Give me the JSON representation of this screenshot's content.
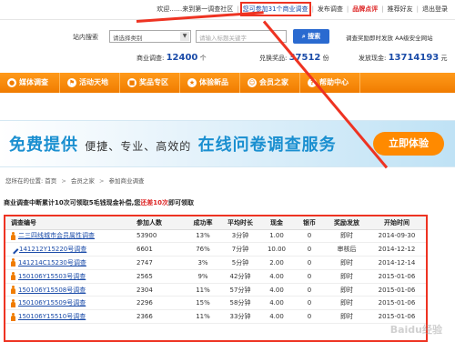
{
  "topbar": {
    "welcome": "欢迎……来到第一调查社区",
    "highlight": "您可参加31个商业调查",
    "publish": "发布调查",
    "brand": "品牌点评",
    "recommend": "推荐好友",
    "logout": "退出登录"
  },
  "search": {
    "label": "站内搜索",
    "select_value": "请选择类别",
    "input_placeholder": "请输入标题关键字",
    "button": "搜索",
    "extra": "调查奖励即时发放  AA级安全网站"
  },
  "stats": {
    "commercial_label": "商业调查:",
    "commercial_value": "12400",
    "commercial_unit": "个",
    "prize_label": "兑换奖品:",
    "prize_value": "37512",
    "prize_unit": "份",
    "cash_label": "发放现金:",
    "cash_value": "13714193",
    "cash_unit": "元"
  },
  "nav": {
    "items": [
      {
        "label": "媒体调查",
        "icon": "flame-icon"
      },
      {
        "label": "活动天地",
        "icon": "flag-icon"
      },
      {
        "label": "奖品专区",
        "icon": "gift-icon"
      },
      {
        "label": "体验新品",
        "icon": "star-icon"
      },
      {
        "label": "会员之家",
        "icon": "user-icon"
      },
      {
        "label": "帮助中心",
        "icon": "help-icon"
      }
    ]
  },
  "banner": {
    "text_main": "免费提供",
    "text_mid": "便捷、专业、高效的",
    "text_tail": "在线问卷调查服务",
    "cta": "立即体验"
  },
  "breadcrumb": {
    "prefix": "您所在的位置:",
    "home": "首页",
    "section": "会员之家",
    "current": "参加商业调查"
  },
  "notice": {
    "text": "商业调查中断累计10次可领取5毛钱现金补偿,您",
    "red": "还差10次",
    "tail": "即可领取"
  },
  "table": {
    "headers": [
      "调查编号",
      "参加人数",
      "成功率",
      "平均时长",
      "现金",
      "银币",
      "奖励发放",
      "开始时间"
    ],
    "rows": [
      {
        "id": "二三四线城市会员属性调查",
        "people": "53900",
        "rate": "13%",
        "time": "3分钟",
        "cash": "1.00",
        "coin": "0",
        "reward": "即时",
        "date": "2014-09-30",
        "icon": "person-icon"
      },
      {
        "id": "141212Y15220号调查",
        "people": "6601",
        "rate": "76%",
        "time": "7分钟",
        "cash": "10.00",
        "coin": "0",
        "reward": "审核后",
        "date": "2014-12-12",
        "icon": "pen-icon"
      },
      {
        "id": "141214C15230号调查",
        "people": "2747",
        "rate": "3%",
        "time": "5分钟",
        "cash": "2.00",
        "coin": "0",
        "reward": "即时",
        "date": "2014-12-14",
        "icon": "person-icon"
      },
      {
        "id": "150106Y15503号调查",
        "people": "2565",
        "rate": "9%",
        "time": "42分钟",
        "cash": "4.00",
        "coin": "0",
        "reward": "即时",
        "date": "2015-01-06",
        "icon": "person-icon"
      },
      {
        "id": "150106Y15508号调查",
        "people": "2304",
        "rate": "11%",
        "time": "57分钟",
        "cash": "4.00",
        "coin": "0",
        "reward": "即时",
        "date": "2015-01-06",
        "icon": "person-icon"
      },
      {
        "id": "150106Y15509号调查",
        "people": "2296",
        "rate": "15%",
        "time": "58分钟",
        "cash": "4.00",
        "coin": "0",
        "reward": "即时",
        "date": "2015-01-06",
        "icon": "person-icon"
      },
      {
        "id": "150106Y15510号调查",
        "people": "2366",
        "rate": "11%",
        "time": "33分钟",
        "cash": "4.00",
        "coin": "0",
        "reward": "即时",
        "date": "2015-01-06",
        "icon": "person-icon"
      }
    ]
  },
  "watermark": "Baidu经验",
  "colors": {
    "accent": "#f07c00",
    "link": "#1a4ba8",
    "highlight": "#e32222"
  }
}
